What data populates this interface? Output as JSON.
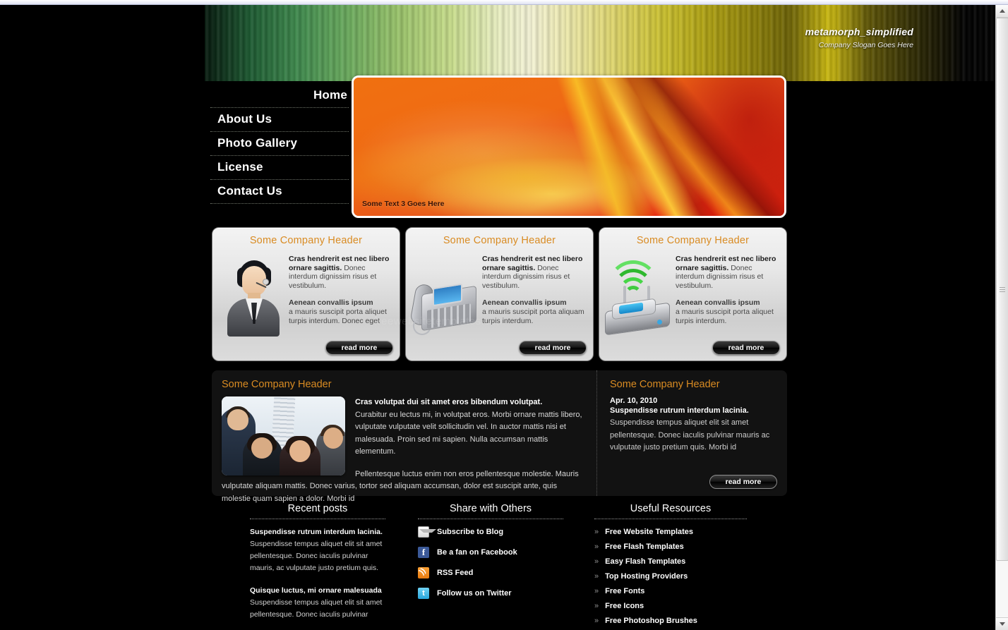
{
  "header": {
    "brand_name": "metamorph_simplified",
    "slogan": "Company Slogan Goes Here"
  },
  "nav": {
    "items": [
      {
        "label": "Home"
      },
      {
        "label": "About Us"
      },
      {
        "label": "Photo Gallery"
      },
      {
        "label": "License"
      },
      {
        "label": "Contact Us"
      }
    ]
  },
  "hero": {
    "caption": "Some Text 3 Goes Here"
  },
  "features": [
    {
      "title": "Some Company Header",
      "icon": "headset-operator-icon",
      "lead": "Cras hendrerit est nec libero ornare sagittis.",
      "body": "Donec interdum dignissim risus et vestibulum.",
      "sub_lead": "Aenean convallis ipsum",
      "sub_body": "a mauris suscipit porta aliquet turpis interdum. Donec eget",
      "button": "read more"
    },
    {
      "title": "Some Company Header",
      "icon": "desk-phone-icon",
      "lead": "Cras hendrerit est nec libero ornare sagittis.",
      "body": "Donec interdum dignissim risus et vestibulum.",
      "sub_lead": "Aenean convallis ipsum",
      "sub_body": "a mauris suscipit porta aliquam turpis interdum.",
      "button": "read more"
    },
    {
      "title": "Some Company Header",
      "icon": "wireless-router-icon",
      "lead": "Cras hendrerit est nec libero ornare sagittis.",
      "body": "Donec interdum dignissim risus et vestibulum.",
      "sub_lead": "Aenean convallis ipsum",
      "sub_body": "a mauris suscipit porta aliquet turpis interdum.",
      "button": "read more"
    }
  ],
  "content": {
    "left": {
      "title": "Some Company Header",
      "lead": "Cras volutpat dui sit amet eros bibendum volutpat.",
      "para1": "Curabitur eu lectus mi, in volutpat eros. Morbi ornare mattis libero, vulputate vulputate velit sollicitudin vel. In auctor mattis nisi et malesuada. Proin sed mi sapien. Nulla accumsan mattis elementum.",
      "para2": "Pellentesque luctus enim non eros pellentesque molestie. Mauris vulputate aliquam mattis. Donec varius, tortor sed aliquam accumsan, dolor est suscipit ante, quis molestie quam sapien a dolor. Morbi id"
    },
    "right": {
      "title": "Some Company Header",
      "date": "Apr. 10, 2010",
      "headline": "Suspendisse rutrum interdum lacinia.",
      "body": "Suspendisse tempus aliquet elit sit amet pellentesque. Donec iaculis pulvinar mauris ac vulputate justo pretium quis. Morbi id",
      "button": "read more"
    }
  },
  "footer": {
    "recent_posts": {
      "title": "Recent posts",
      "posts": [
        {
          "title": "Suspendisse rutrum interdum lacinia.",
          "body": "Suspendisse tempus aliquet elit sit amet pellentesque. Donec iaculis pulvinar mauris, ac vulputate justo pretium quis."
        },
        {
          "title": "Quisque luctus, mi ornare malesuada",
          "body": "Suspendisse tempus aliquet elit sit amet pellentesque. Donec iaculis pulvinar"
        }
      ]
    },
    "share": {
      "title": "Share with Others",
      "items": [
        {
          "label": "Subscribe to Blog",
          "icon": "mail-icon"
        },
        {
          "label": "Be a fan on Facebook",
          "icon": "facebook-icon"
        },
        {
          "label": "RSS Feed",
          "icon": "rss-icon"
        },
        {
          "label": "Follow us on Twitter",
          "icon": "twitter-icon"
        }
      ]
    },
    "resources": {
      "title": "Useful Resources",
      "items": [
        {
          "label": "Free Website Templates"
        },
        {
          "label": "Free Flash Templates"
        },
        {
          "label": "Easy Flash Templates"
        },
        {
          "label": "Top Hosting Providers"
        },
        {
          "label": "Free Fonts"
        },
        {
          "label": "Free Icons"
        },
        {
          "label": "Free Photoshop Brushes"
        }
      ]
    }
  },
  "watermark": {
    "text": "freewebsitetemplates.com"
  },
  "colors": {
    "accent_orange": "#d98b22",
    "hero_orange": "#ef6a14",
    "hero_red": "#d92e12",
    "page_background": "#000000",
    "panel_background": "#121212"
  }
}
